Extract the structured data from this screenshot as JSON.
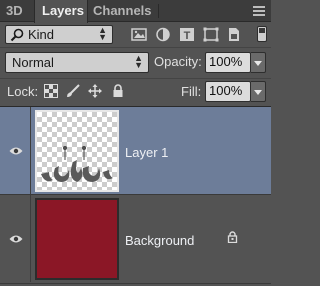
{
  "tabs": [
    "3D",
    "Layers",
    "Channels"
  ],
  "filter": {
    "kind_label": "Kind"
  },
  "blend": {
    "mode": "Normal",
    "opacity_label": "Opacity:",
    "opacity_value": "100%"
  },
  "lock": {
    "label": "Lock:",
    "fill_label": "Fill:",
    "fill_value": "100%"
  },
  "layers": [
    {
      "name": "Layer 1",
      "selected": true,
      "visible": true
    },
    {
      "name": "Background",
      "selected": false,
      "visible": true,
      "locked": true,
      "fill_color": "#8b1726"
    }
  ],
  "colors": {
    "panel_bg": "#535353",
    "selection": "#6d7d99",
    "tab_bar": "#3c3c3c"
  }
}
